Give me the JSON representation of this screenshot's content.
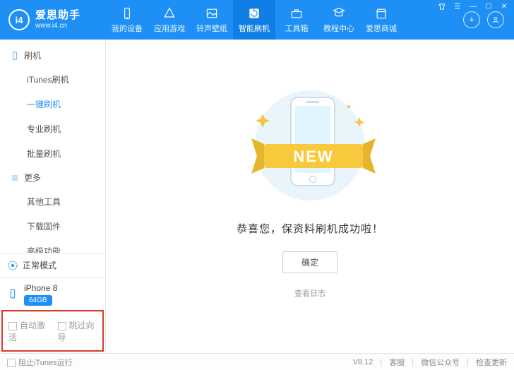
{
  "app": {
    "title": "爱思助手",
    "url": "www.i4.cn"
  },
  "nav": {
    "items": [
      {
        "label": "我的设备"
      },
      {
        "label": "应用游戏"
      },
      {
        "label": "铃声壁纸"
      },
      {
        "label": "智能刷机"
      },
      {
        "label": "工具箱"
      },
      {
        "label": "教程中心"
      },
      {
        "label": "爱思商城"
      }
    ]
  },
  "sidebar": {
    "section1": {
      "title": "刷机"
    },
    "section1_items": [
      {
        "label": "iTunes刷机"
      },
      {
        "label": "一键刷机"
      },
      {
        "label": "专业刷机"
      },
      {
        "label": "批量刷机"
      }
    ],
    "section2": {
      "title": "更多"
    },
    "section2_items": [
      {
        "label": "其他工具"
      },
      {
        "label": "下载固件"
      },
      {
        "label": "高级功能"
      }
    ],
    "status": {
      "label": "正常模式"
    },
    "device": {
      "name": "iPhone 8",
      "storage": "64GB"
    },
    "options": {
      "auto_activate": "自动激活",
      "skip_guide": "跳过向导"
    }
  },
  "main": {
    "banner_word": "NEW",
    "success": "恭喜您，保资料刷机成功啦！",
    "ok": "确定",
    "view_log": "查看日志"
  },
  "footer": {
    "block_itunes": "阻止iTunes运行",
    "version": "V8.12",
    "support": "客服",
    "wechat": "微信公众号",
    "update": "检查更新"
  }
}
